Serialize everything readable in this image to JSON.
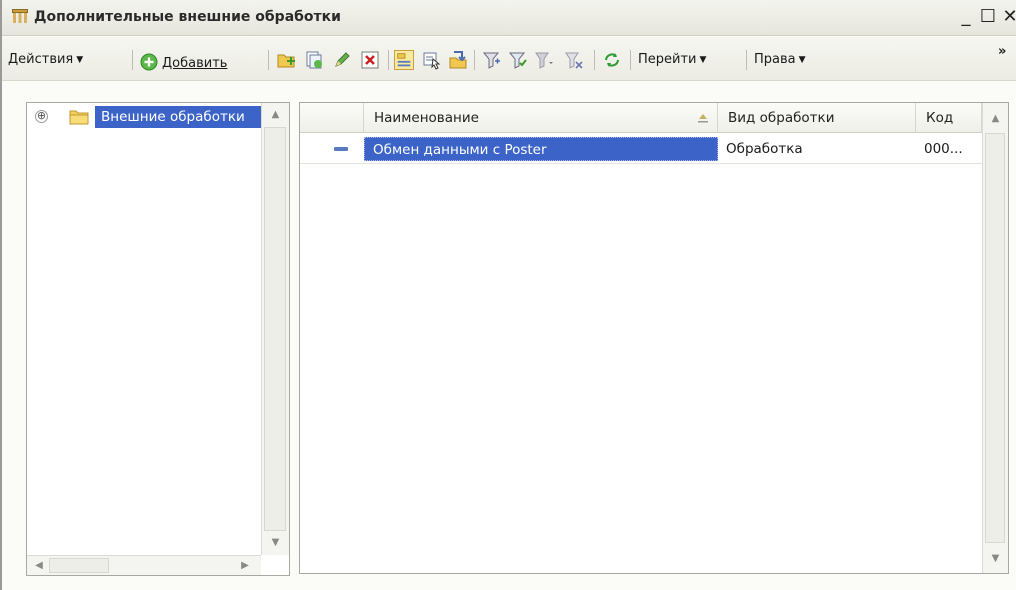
{
  "window": {
    "title": "Дополнительные внешние обработки",
    "min_glyph": "_",
    "max_glyph": "☐",
    "close_glyph": "✕"
  },
  "toolbar": {
    "actions_label": "Действия",
    "add_label": "Добавить",
    "goto_label": "Перейти",
    "rights_label": "Права",
    "more_glyph": "»",
    "icons": [
      "add-group-icon",
      "copy-icon",
      "edit-icon",
      "delete-icon",
      "hierarchy-icon",
      "select-icon",
      "move-to-group-icon",
      "filter-icon",
      "filter-value-icon",
      "filter-dropdown-icon",
      "clear-filter-icon",
      "refresh-icon"
    ]
  },
  "tree": {
    "root_label": "Внешние обработки",
    "expander_glyph": "⊕"
  },
  "list": {
    "columns": [
      "Наименование",
      "Вид обработки",
      "Код"
    ],
    "rows": [
      {
        "name": "Обмен данными с Poster",
        "kind": "Обработка",
        "code": "000..."
      }
    ]
  },
  "colors": {
    "selection": "#3c64c8",
    "window_bg": "#fbfbf7"
  }
}
